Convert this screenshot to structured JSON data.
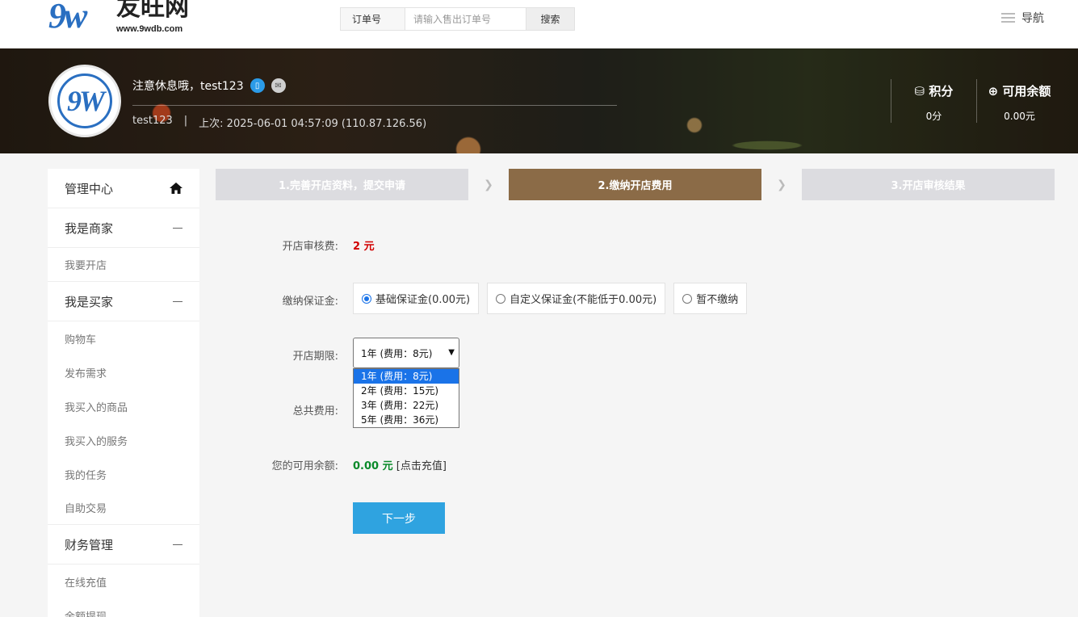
{
  "header": {
    "logo_mark": "9w",
    "logo_name": "友旺网",
    "logo_url": "www.9wdb.com",
    "search_type": "订单号",
    "search_placeholder": "请输入售出订单号",
    "search_button": "搜索",
    "nav_label": "导航"
  },
  "profile": {
    "avatar_mark": "9W",
    "greeting": "注意休息哦，test123",
    "username": "test123",
    "separator": "|",
    "last_login": "上次: 2025-06-01 04:57:09 (110.87.126.56)",
    "stats": [
      {
        "title": "⛁ 积分",
        "value": "0分"
      },
      {
        "title": "⊕ 可用余额",
        "value": "0.00元"
      }
    ]
  },
  "sidebar": {
    "home": "管理中心",
    "groups": [
      {
        "title": "我是商家",
        "items": [
          "我要开店"
        ]
      },
      {
        "title": "我是买家",
        "items": [
          "购物车",
          "发布需求",
          "我买入的商品",
          "我买入的服务",
          "我的任务",
          "自助交易"
        ]
      },
      {
        "title": "财务管理",
        "items": [
          "在线充值",
          "余额提现"
        ]
      }
    ]
  },
  "steps": [
    {
      "label": "1.完善开店资料，提交申请",
      "active": false
    },
    {
      "label": "2.缴纳开店费用",
      "active": true
    },
    {
      "label": "3.开店审核结果",
      "active": false
    }
  ],
  "step_arrow": "❯",
  "form": {
    "fee_label": "开店审核费:",
    "fee_value": "2 元",
    "deposit_label": "缴纳保证金:",
    "deposit_options": [
      "基础保证金(0.00元)",
      "自定义保证金(不能低于0.00元)",
      "暂不缴纳"
    ],
    "period_label": "开店期限:",
    "period_selected": "1年 (费用：8元)",
    "period_options": [
      "1年 (费用：8元)",
      "2年 (费用：15元)",
      "3年 (费用：22元)",
      "5年 (费用：36元)"
    ],
    "total_label": "总共费用:",
    "balance_label": "您的可用余额:",
    "balance_value": "0.00 元",
    "recharge_link": "[点击充值]",
    "next_button": "下一步"
  },
  "colors": {
    "accent": "#2fa3e0",
    "step_active": "#8b6b47",
    "fee": "#d10000",
    "balance": "#0a8a2a"
  }
}
